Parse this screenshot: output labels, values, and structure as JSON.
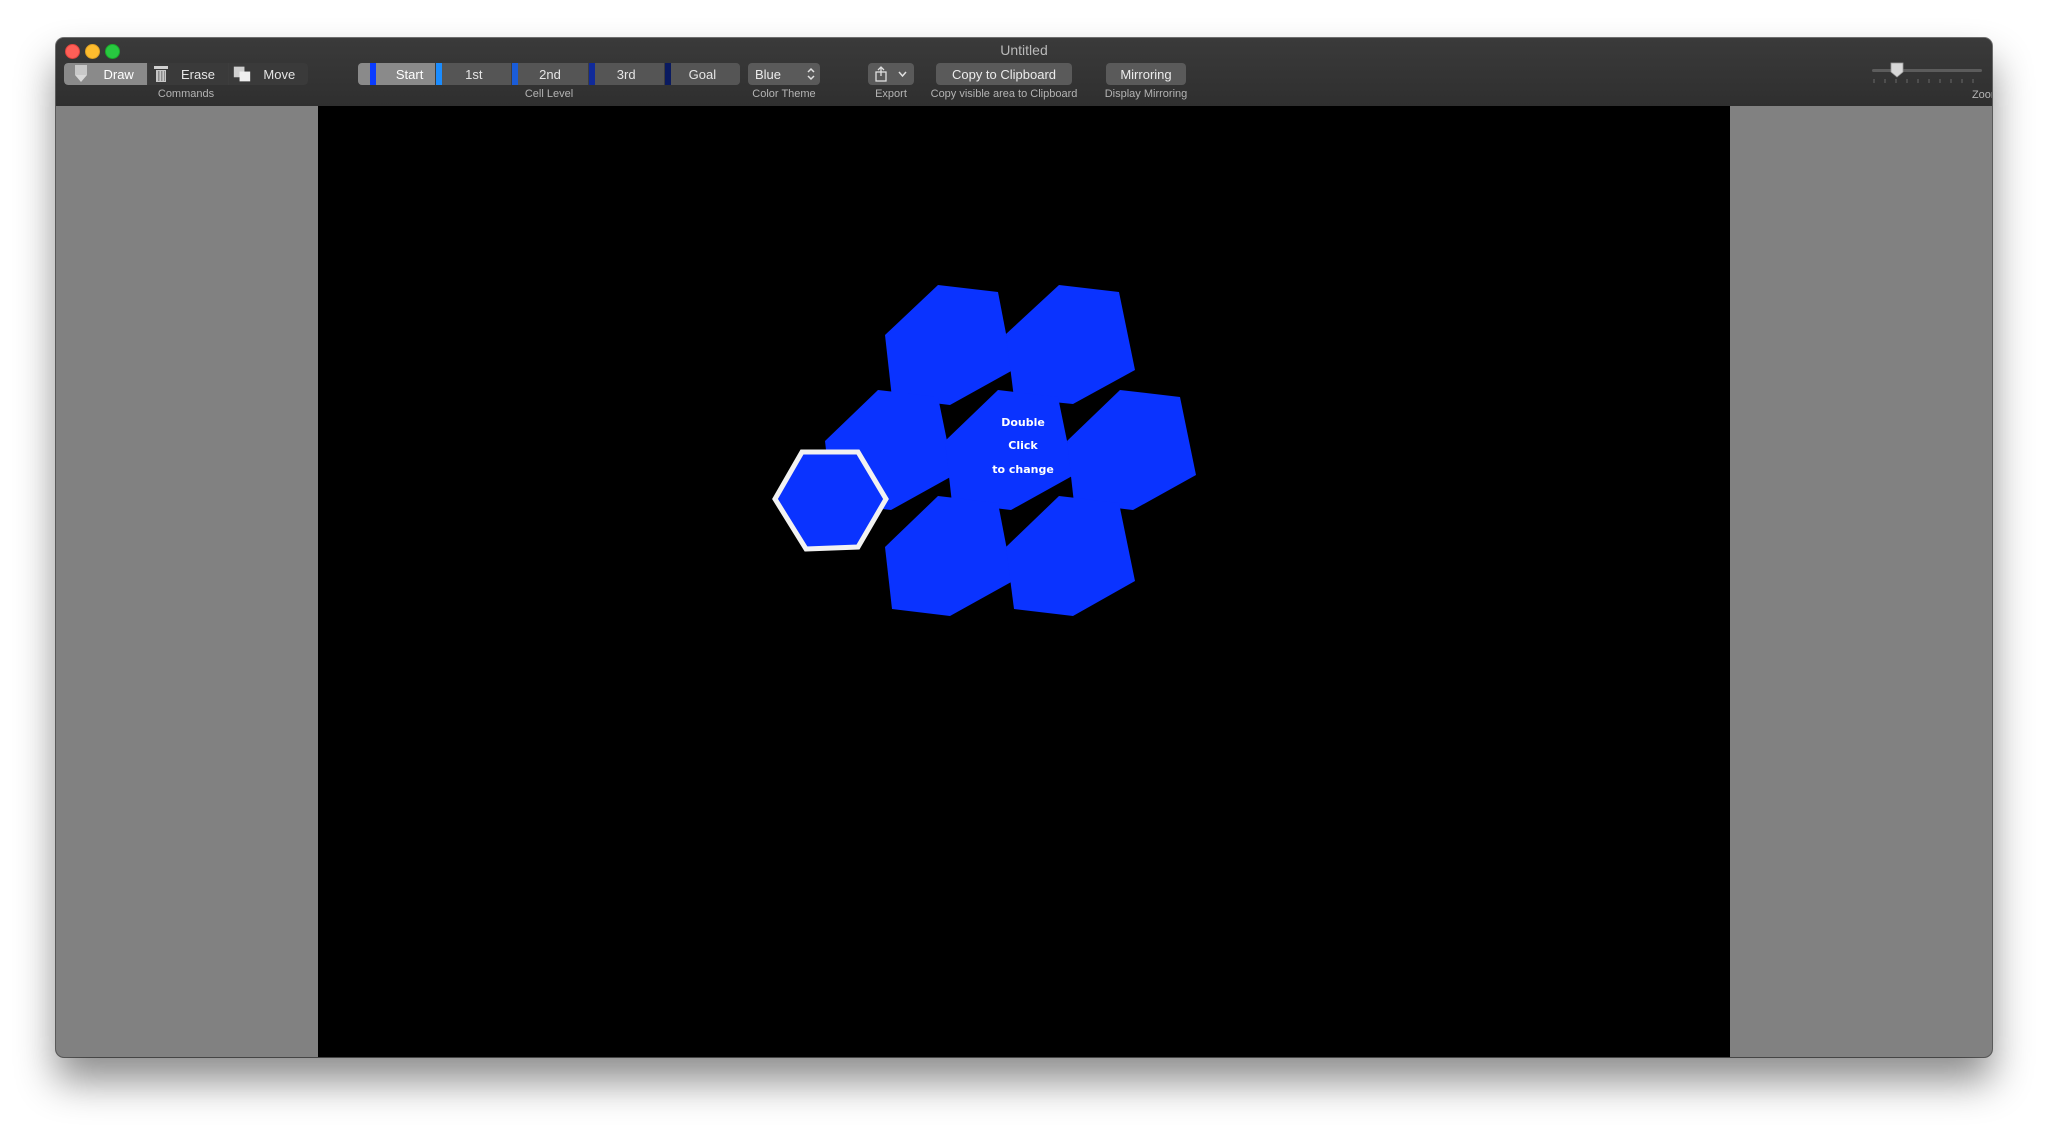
{
  "window": {
    "title": "Untitled"
  },
  "toolbar": {
    "commands": {
      "caption": "Commands",
      "draw": "Draw",
      "erase": "Erase",
      "move": "Move",
      "selected": "draw"
    },
    "cell_level": {
      "caption": "Cell Level",
      "items": [
        {
          "label": "Start",
          "color": "#0a3cff",
          "selected": true
        },
        {
          "label": "1st",
          "color": "#1a8cff",
          "selected": false
        },
        {
          "label": "2nd",
          "color": "#1a5cd8",
          "selected": false
        },
        {
          "label": "3rd",
          "color": "#102a9a",
          "selected": false
        },
        {
          "label": "Goal",
          "color": "#0a1a60",
          "selected": false
        }
      ]
    },
    "color_theme": {
      "caption": "Color Theme",
      "value": "Blue"
    },
    "export": {
      "caption": "Export"
    },
    "copy": {
      "label": "Copy to Clipboard",
      "caption": "Copy visible area to Clipboard"
    },
    "mirroring": {
      "label": "Mirroring",
      "caption": "Display Mirroring"
    },
    "zoom": {
      "caption": "Zoom",
      "level": 0.18
    }
  },
  "canvas": {
    "background": "#000000",
    "cell_color": "#0a33ff",
    "center_hint": {
      "line1": "Double",
      "line2": "Click",
      "line3": "to change"
    },
    "cells": [
      {
        "id": "cell-top-left"
      },
      {
        "id": "cell-top-right"
      },
      {
        "id": "cell-mid-left"
      },
      {
        "id": "cell-mid-center"
      },
      {
        "id": "cell-mid-right"
      },
      {
        "id": "cell-bottom-left",
        "selected": true
      },
      {
        "id": "cell-bottom-center"
      },
      {
        "id": "cell-bottom-right"
      }
    ]
  }
}
